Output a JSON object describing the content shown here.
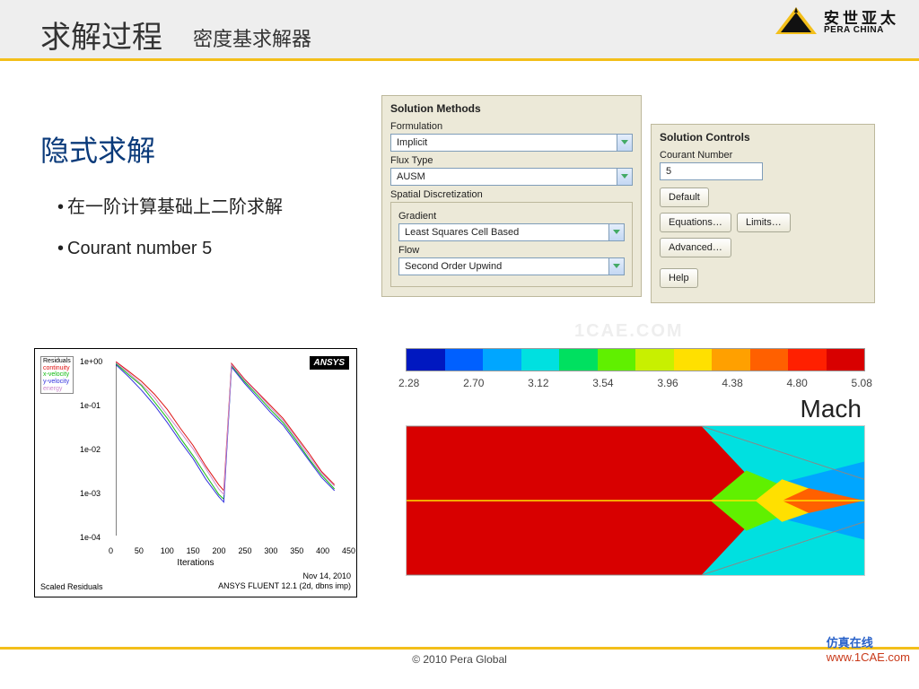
{
  "header": {
    "title_main": "求解过程",
    "title_sub": "密度基求解器",
    "logo_cn": "安世亚太",
    "logo_en": "PERA CHINA"
  },
  "section": {
    "title": "隐式求解",
    "bullets": [
      "在一阶计算基础上二阶求解",
      "Courant number 5"
    ]
  },
  "panels": {
    "methods": {
      "title": "Solution Methods",
      "formulation_label": "Formulation",
      "formulation_value": "Implicit",
      "flux_label": "Flux Type",
      "flux_value": "AUSM",
      "spatial_label": "Spatial Discretization",
      "gradient_label": "Gradient",
      "gradient_value": "Least Squares Cell Based",
      "flow_label": "Flow",
      "flow_value": "Second Order Upwind"
    },
    "controls": {
      "title": "Solution Controls",
      "courant_label": "Courant Number",
      "courant_value": "5",
      "buttons": {
        "default": "Default",
        "equations": "Equations…",
        "limits": "Limits…",
        "advanced": "Advanced…",
        "help": "Help"
      }
    }
  },
  "residual_chart": {
    "ansys": "ANSYS",
    "legend": [
      "Residuals",
      "continuity",
      "x-velocity",
      "y-velocity",
      "energy"
    ],
    "legend_colors": [
      "#000",
      "#d11",
      "#1b1",
      "#33d",
      "#c8c"
    ],
    "bottom_left": "Scaled Residuals",
    "bottom_right_1": "Nov 14, 2010",
    "bottom_right_2": "ANSYS FLUENT 12.1 (2d, dbns imp)",
    "xaxis_title": "Iterations"
  },
  "mach": {
    "label": "Mach",
    "ticks": [
      "2.28",
      "2.70",
      "3.12",
      "3.54",
      "3.96",
      "4.38",
      "4.80",
      "5.08"
    ],
    "colors": [
      "#0018c0",
      "#0060ff",
      "#00a6ff",
      "#00e0e0",
      "#00e060",
      "#60f000",
      "#c8f000",
      "#ffe000",
      "#ffa000",
      "#ff6000",
      "#ff2000",
      "#d80000"
    ]
  },
  "footer": {
    "copyright": "© 2010 Pera Global"
  },
  "watermark": {
    "l1": "仿真在线",
    "l2": "www.1CAE.com"
  },
  "faint": "1CAE.COM",
  "chart_data": {
    "type": "line",
    "title": "Scaled Residuals",
    "xlabel": "Iterations",
    "ylabel": "",
    "xlim": [
      0,
      450
    ],
    "ylim": [
      0.0001,
      1.0
    ],
    "yscale": "log",
    "x_ticks": [
      0,
      50,
      100,
      150,
      200,
      250,
      300,
      350,
      400,
      450
    ],
    "y_ticks": [
      1.0,
      0.1,
      0.01,
      0.001,
      0.0001
    ],
    "y_tick_labels": [
      "1e+00",
      "1e-01",
      "1e-02",
      "1e-03",
      "1e-04"
    ],
    "x": [
      0,
      25,
      50,
      75,
      100,
      125,
      150,
      175,
      200,
      210,
      225,
      250,
      275,
      300,
      325,
      350,
      375,
      400,
      425
    ],
    "series": [
      {
        "name": "continuity",
        "color": "#d11",
        "values": [
          1.0,
          0.6,
          0.35,
          0.18,
          0.08,
          0.03,
          0.012,
          0.004,
          0.0015,
          0.0011,
          0.9,
          0.4,
          0.2,
          0.1,
          0.05,
          0.02,
          0.008,
          0.003,
          0.0015
        ]
      },
      {
        "name": "x-velocity",
        "color": "#1b1",
        "values": [
          0.9,
          0.5,
          0.28,
          0.12,
          0.05,
          0.018,
          0.007,
          0.0025,
          0.0009,
          0.0007,
          0.8,
          0.35,
          0.17,
          0.08,
          0.04,
          0.016,
          0.006,
          0.0025,
          0.0012
        ]
      },
      {
        "name": "y-velocity",
        "color": "#33d",
        "values": [
          0.85,
          0.45,
          0.22,
          0.1,
          0.04,
          0.015,
          0.006,
          0.002,
          0.0008,
          0.0006,
          0.75,
          0.32,
          0.15,
          0.07,
          0.035,
          0.014,
          0.0055,
          0.0022,
          0.0011
        ]
      },
      {
        "name": "energy",
        "color": "#c8c",
        "values": [
          0.95,
          0.55,
          0.3,
          0.15,
          0.06,
          0.025,
          0.01,
          0.0035,
          0.0012,
          0.0009,
          0.85,
          0.38,
          0.19,
          0.09,
          0.045,
          0.018,
          0.007,
          0.0028,
          0.0014
        ]
      }
    ]
  }
}
